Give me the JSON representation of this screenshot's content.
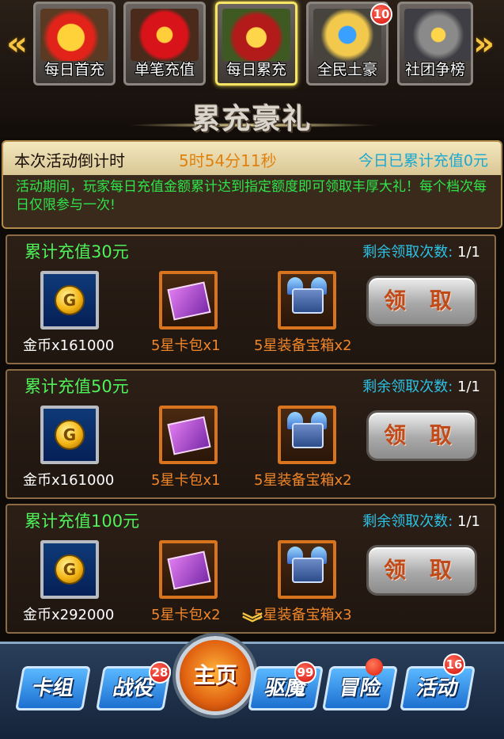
{
  "top_tabs": [
    {
      "label": "每日首充",
      "icon": "gift-box-icon",
      "selected": false,
      "badge": ""
    },
    {
      "label": "单笔充值",
      "icon": "red-money-bag-icon",
      "selected": false,
      "badge": ""
    },
    {
      "label": "每日累充",
      "icon": "treasure-chest-icon",
      "selected": true,
      "badge": ""
    },
    {
      "label": "全民土豪",
      "icon": "crowned-shield-icon",
      "selected": false,
      "badge": "10"
    },
    {
      "label": "社团争榜",
      "icon": "knight-helmet-icon",
      "selected": false,
      "badge": ""
    }
  ],
  "arrows": {
    "left": "«",
    "right": "»"
  },
  "title": "累充豪礼",
  "info": {
    "countdown_label": "本次活动倒计时",
    "countdown_value": "5时54分11秒",
    "today_total": "今日已累计充值0元",
    "description": "活动期间，玩家每日充值金额累计达到指定额度即可领取丰厚大礼！每个档次每日仅限参与一次!"
  },
  "tiers": [
    {
      "title": "累计充值30元",
      "remaining_label": "剩余领取次数: ",
      "remaining_value": "1/1",
      "claim_label": "领 取",
      "rewards": [
        {
          "label": "金币x161000",
          "icon": "gold-coin-icon"
        },
        {
          "label": "5星卡包x1",
          "icon": "card-pack-icon"
        },
        {
          "label": "5星装备宝箱x2",
          "icon": "winged-chest-icon"
        }
      ]
    },
    {
      "title": "累计充值50元",
      "remaining_label": "剩余领取次数: ",
      "remaining_value": "1/1",
      "claim_label": "领 取",
      "rewards": [
        {
          "label": "金币x161000",
          "icon": "gold-coin-icon"
        },
        {
          "label": "5星卡包x1",
          "icon": "card-pack-icon"
        },
        {
          "label": "5星装备宝箱x2",
          "icon": "winged-chest-icon"
        }
      ]
    },
    {
      "title": "累计充值100元",
      "remaining_label": "剩余领取次数: ",
      "remaining_value": "1/1",
      "claim_label": "领 取",
      "rewards": [
        {
          "label": "金币x292000",
          "icon": "gold-coin-icon"
        },
        {
          "label": "5星卡包x2",
          "icon": "card-pack-icon"
        },
        {
          "label": "5星装备宝箱x3",
          "icon": "winged-chest-icon"
        }
      ]
    }
  ],
  "bottom_nav": {
    "cards": {
      "label": "卡组",
      "badge": ""
    },
    "campaign": {
      "label": "战役",
      "badge": "28"
    },
    "home": {
      "label": "主页"
    },
    "demon": {
      "label": "驱魔",
      "badge": "99"
    },
    "adventure": {
      "label": "冒险",
      "badge": ""
    },
    "activity": {
      "label": "活动",
      "badge": "16"
    }
  },
  "colors": {
    "tier_title": "#4ff25a",
    "remaining": "#2cc2e6",
    "countdown": "#e0810e",
    "description": "#2fe44a",
    "reward_orange": "#f2862a"
  }
}
